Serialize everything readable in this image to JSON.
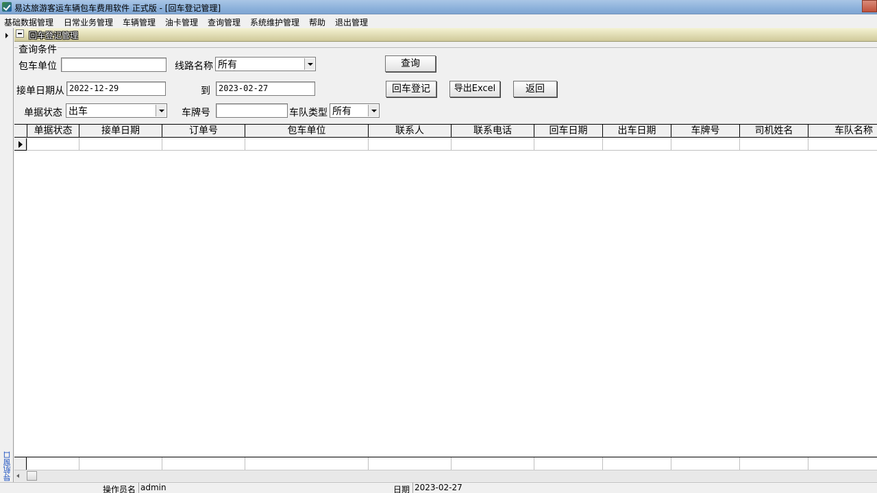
{
  "window": {
    "title": "易达旅游客运车辆包车费用软件 正式版   - [回车登记管理]"
  },
  "menu": [
    "基础数据管理",
    "日常业务管理",
    "车辆管理",
    "油卡管理",
    "查询管理",
    "系统维护管理",
    "帮助",
    "退出管理"
  ],
  "nav_label": "导航窗口",
  "section_title": "回车登记管理",
  "query": {
    "group_title": "查询条件",
    "charter_unit_label": "包车单位",
    "charter_unit_value": "",
    "route_label": "线路名称",
    "route_value": "所有",
    "date_from_label": "接单日期从",
    "date_from_value": "2022-12-29",
    "date_to_label": "到",
    "date_to_value": "2023-02-27",
    "status_label": "单据状态",
    "status_value": "出车",
    "plate_label": "车牌号",
    "plate_value": "",
    "team_type_label": "车队类型",
    "team_type_value": "所有"
  },
  "buttons": {
    "query": "查询",
    "return_register": "回车登记",
    "export_excel": "导出Excel",
    "back": "返回"
  },
  "table": {
    "columns": [
      "单据状态",
      "接单日期",
      "订单号",
      "包车单位",
      "联系人",
      "联系电话",
      "回车日期",
      "出车日期",
      "车牌号",
      "司机姓名",
      "车队名称"
    ]
  },
  "status": {
    "operator_label": "操作员名",
    "operator_value": "admin",
    "date_label": "日期",
    "date_value": "2023-02-27"
  }
}
